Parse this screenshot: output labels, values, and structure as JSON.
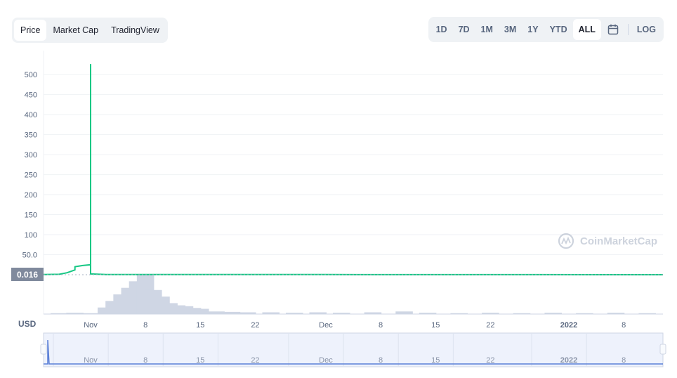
{
  "chart_tabs": [
    {
      "label": "Price",
      "active": true
    },
    {
      "label": "Market Cap",
      "active": false
    },
    {
      "label": "TradingView",
      "active": false
    }
  ],
  "range_buttons": [
    {
      "label": "1D",
      "active": false
    },
    {
      "label": "7D",
      "active": false
    },
    {
      "label": "1M",
      "active": false
    },
    {
      "label": "3M",
      "active": false
    },
    {
      "label": "1Y",
      "active": false
    },
    {
      "label": "YTD",
      "active": false
    },
    {
      "label": "ALL",
      "active": true
    }
  ],
  "calendar_icon": "calendar-icon",
  "log_label": "LOG",
  "watermark": "CoinMarketCap",
  "current_price_label": "0.016",
  "currency_label": "USD",
  "colors": {
    "line": "#16c784",
    "volume": "#cfd6e4",
    "navigator_line": "#5a7fd6",
    "navigator_bg": "#eef2fc",
    "price_tag": "#808a9d"
  },
  "chart_data": {
    "type": "line",
    "title": "",
    "xlabel": "",
    "ylabel": "",
    "y_tick_labels": [
      "50.0",
      "100",
      "150",
      "200",
      "250",
      "300",
      "350",
      "400",
      "450",
      "500"
    ],
    "y_ticks": [
      50,
      100,
      150,
      200,
      250,
      300,
      350,
      400,
      450,
      500
    ],
    "ylim": [
      0,
      520
    ],
    "x_ticks": [
      {
        "label": "Nov",
        "date": "2021-11-01"
      },
      {
        "label": "8",
        "date": "2021-11-08"
      },
      {
        "label": "15",
        "date": "2021-11-15"
      },
      {
        "label": "22",
        "date": "2021-11-22"
      },
      {
        "label": "Dec",
        "date": "2021-12-01"
      },
      {
        "label": "8",
        "date": "2021-12-08"
      },
      {
        "label": "15",
        "date": "2021-12-15"
      },
      {
        "label": "22",
        "date": "2021-12-22"
      },
      {
        "label": "2022",
        "date": "2022-01-01"
      },
      {
        "label": "8",
        "date": "2022-01-08"
      }
    ],
    "xlim": [
      "2021-10-26",
      "2022-01-13"
    ],
    "grid": true,
    "series": [
      {
        "values": [
          {
            "date": "2021-10-26",
            "price": 0.5
          },
          {
            "date": "2021-10-28",
            "price": 1
          },
          {
            "date": "2021-10-29",
            "price": 5
          },
          {
            "date": "2021-10-30",
            "price": 12
          },
          {
            "date": "2021-10-30",
            "price": 20
          },
          {
            "date": "2021-10-31",
            "price": 23
          },
          {
            "date": "2021-11-01",
            "price": 25
          },
          {
            "date": "2021-11-01",
            "price": 525
          },
          {
            "date": "2021-11-01",
            "price": 2
          },
          {
            "date": "2021-11-03",
            "price": 0.6
          },
          {
            "date": "2021-12-01",
            "price": 0.3
          },
          {
            "date": "2022-01-13",
            "price": 0.016
          }
        ]
      }
    ],
    "volume": {
      "dates": [
        "2021-10-28",
        "2021-10-30",
        "2021-11-01",
        "2021-11-03",
        "2021-11-04",
        "2021-11-05",
        "2021-11-06",
        "2021-11-07",
        "2021-11-08",
        "2021-11-09",
        "2021-11-10",
        "2021-11-11",
        "2021-11-12",
        "2021-11-13",
        "2021-11-14",
        "2021-11-15",
        "2021-11-17",
        "2021-11-19",
        "2021-11-21",
        "2021-11-24",
        "2021-11-27",
        "2021-11-30",
        "2021-12-03",
        "2021-12-07",
        "2021-12-11",
        "2021-12-14",
        "2021-12-18",
        "2021-12-22",
        "2021-12-26",
        "2021-12-30",
        "2022-01-03",
        "2022-01-07",
        "2022-01-11"
      ],
      "values": [
        2,
        3,
        2,
        15,
        30,
        45,
        60,
        75,
        90,
        55,
        40,
        25,
        20,
        18,
        14,
        12,
        6,
        5,
        4,
        4,
        3,
        4,
        3,
        4,
        6,
        3,
        2,
        3,
        2,
        3,
        2,
        3,
        2
      ]
    }
  }
}
